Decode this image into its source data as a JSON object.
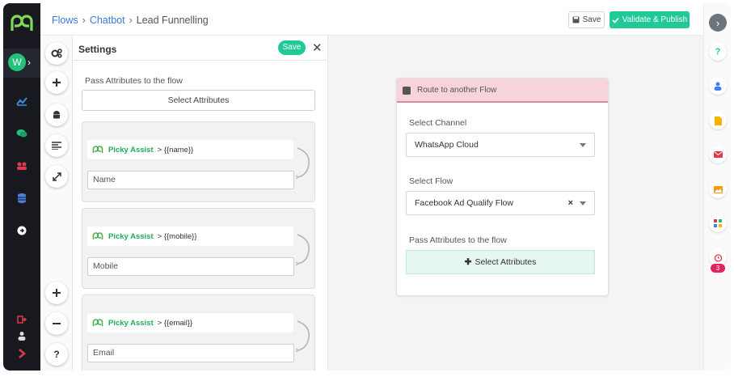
{
  "header": {
    "breadcrumb": [
      "Flows",
      "Chatbot",
      "Lead Funnelling"
    ],
    "save_label": "Save",
    "validate_label": "Validate & Publish"
  },
  "sidebar": {
    "avatar_initial": "W"
  },
  "settings": {
    "title": "Settings",
    "save_label": "Save",
    "pass_attributes_label": "Pass Attributes to the flow",
    "select_attributes_label": "Select Attributes",
    "cards": [
      {
        "brand": "Picky Assist",
        "variable": "> {{name}}",
        "input_value": "Name"
      },
      {
        "brand": "Picky Assist",
        "variable": "> {{mobile}}",
        "input_value": "Mobile"
      },
      {
        "brand": "Picky Assist",
        "variable": "> {{email}}",
        "input_value": "Email"
      }
    ]
  },
  "route_card": {
    "title": "Route to another Flow",
    "channel_label": "Select Channel",
    "channel_value": "WhatsApp Cloud",
    "flow_label": "Select Flow",
    "flow_value": "Facebook Ad Qualify Flow",
    "pass_label": "Pass Attributes to the flow",
    "attr_button_label": "Select Attributes"
  },
  "rightrail": {
    "help_label": "?",
    "badge_count": "3"
  },
  "toolrail": {
    "help_label": "?"
  },
  "colors": {
    "accent_green": "#20c997",
    "sidebar_dark": "#17191f",
    "link_blue": "#3a7bd5",
    "route_header_pink": "#f7d3db"
  }
}
